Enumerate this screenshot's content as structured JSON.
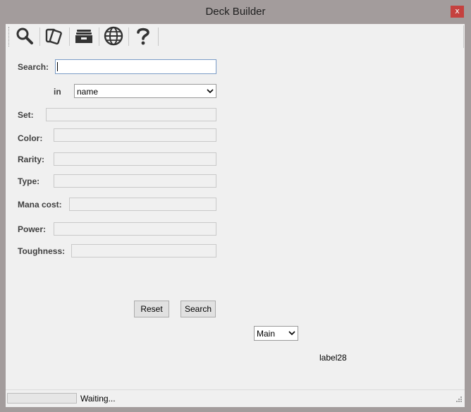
{
  "window": {
    "title": "Deck Builder",
    "close_label": "x"
  },
  "toolbar": {
    "buttons": [
      {
        "icon": "search-icon"
      },
      {
        "icon": "cards-icon"
      },
      {
        "icon": "deck-box-icon"
      },
      {
        "icon": "globe-icon"
      },
      {
        "icon": "help-icon"
      }
    ]
  },
  "form": {
    "search_label": "Search:",
    "search_value": "",
    "in_label": "in",
    "in_selected": "name",
    "set_label": "Set:",
    "color_label": "Color:",
    "rarity_label": "Rarity:",
    "type_label": "Type:",
    "mana_cost_label": "Mana cost:",
    "power_label": "Power:",
    "toughness_label": "Toughness:",
    "reset_label": "Reset",
    "search_button_label": "Search"
  },
  "deck_select": {
    "selected": "Main"
  },
  "misc_label": "label28",
  "status": {
    "text": "Waiting...",
    "progress": 0
  }
}
